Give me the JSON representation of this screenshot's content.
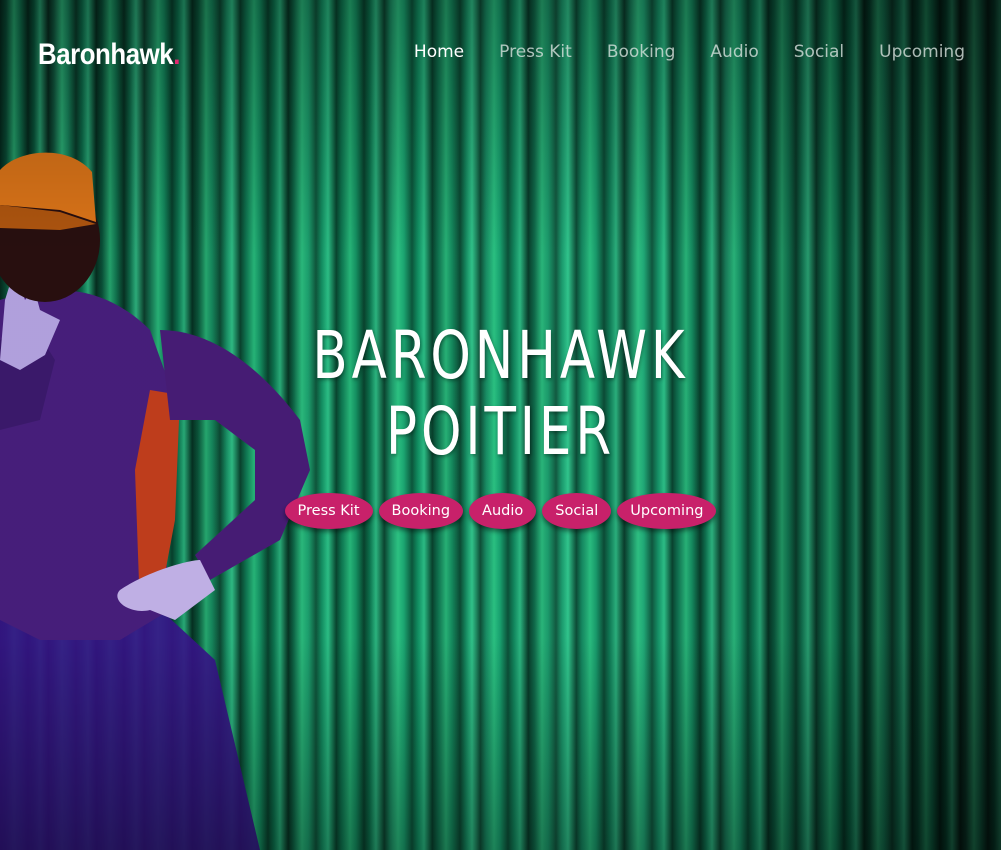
{
  "site": {
    "logo_text": "Baronhawk",
    "logo_dot": ".",
    "accent_color": "#e0266f",
    "pill_color": "#c8216a"
  },
  "nav": {
    "items": [
      {
        "label": "Home",
        "active": true
      },
      {
        "label": "Press Kit",
        "active": false
      },
      {
        "label": "Booking",
        "active": false
      },
      {
        "label": "Audio",
        "active": false
      },
      {
        "label": "Social",
        "active": false
      },
      {
        "label": "Upcoming",
        "active": false
      }
    ]
  },
  "hero": {
    "title_line1": "BARONHAWK",
    "title_line2": "POITIER",
    "buttons": [
      "Press Kit",
      "Booking",
      "Audio",
      "Social",
      "Upcoming"
    ]
  }
}
